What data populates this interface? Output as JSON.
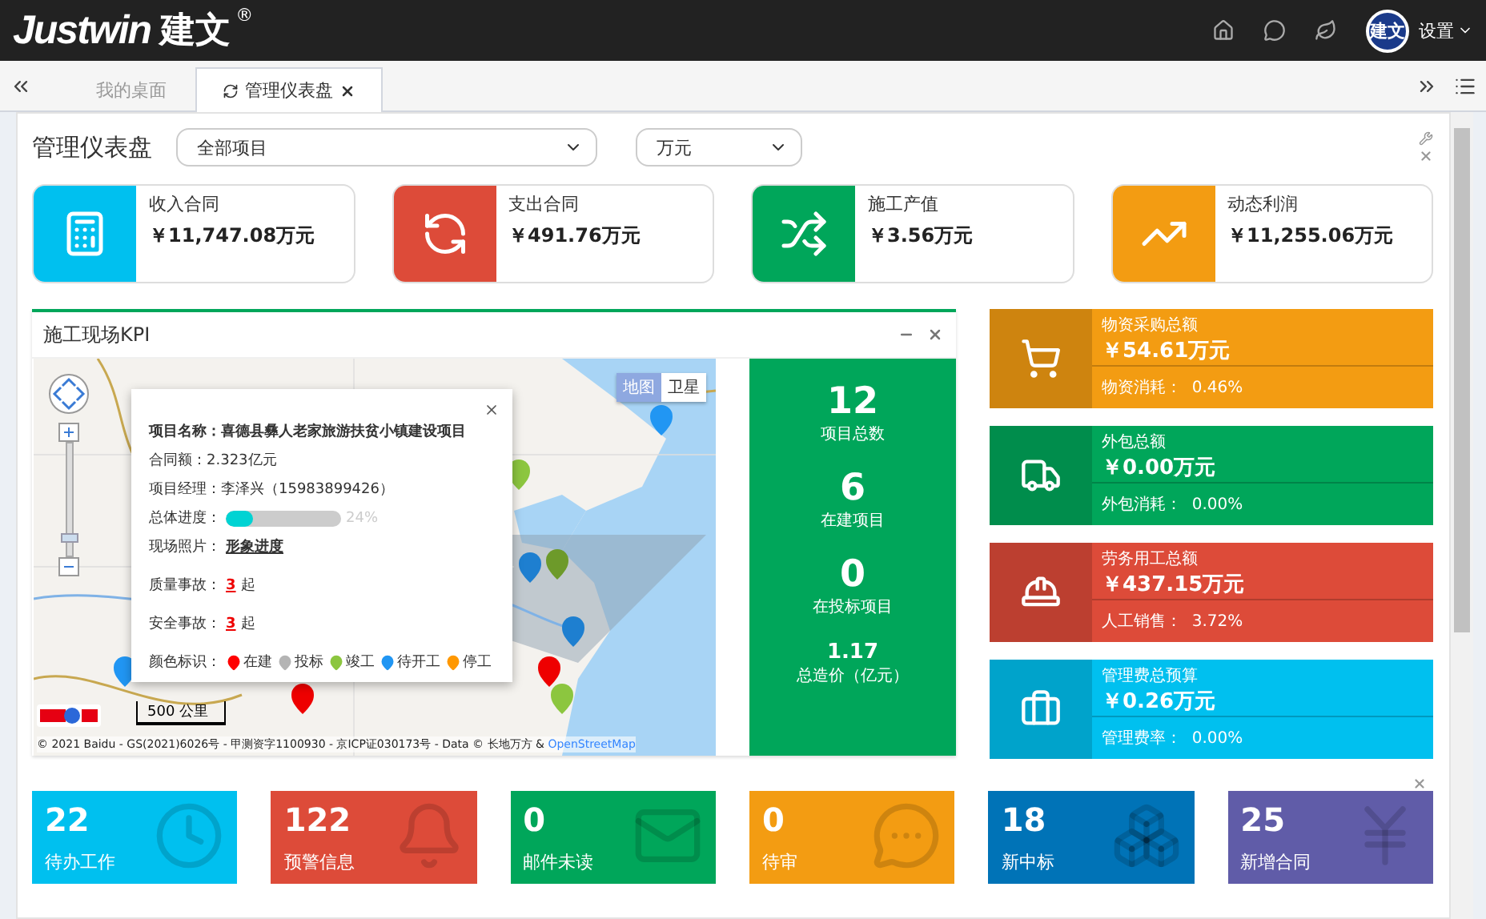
{
  "header": {
    "logo": "Justwin",
    "logo_cn": "建文",
    "registered": "®",
    "avatar": "建文",
    "user_menu": "设置"
  },
  "tabs": [
    {
      "label": "我的桌面",
      "selected": false
    },
    {
      "label": "管理仪表盘",
      "selected": true
    }
  ],
  "page": {
    "title": "管理仪表盘",
    "filters": [
      {
        "value": "全部项目"
      },
      {
        "value": "万元"
      }
    ]
  },
  "stat_cards": [
    {
      "label": "收入合同",
      "value": "￥11,747.08万元",
      "color": "#00c0ef"
    },
    {
      "label": "支出合同",
      "value": "￥491.76万元",
      "color": "#dd4b39"
    },
    {
      "label": "施工产值",
      "value": "￥3.56万元",
      "color": "#00a65a"
    },
    {
      "label": "动态利润",
      "value": "￥11,255.06万元",
      "color": "#f39c12"
    }
  ],
  "map_panel": {
    "title": "施工现场KPI",
    "map_types": [
      {
        "label": "地图",
        "selected": true
      },
      {
        "label": "卫星",
        "selected": false
      }
    ],
    "scale": "500 公里",
    "zoom_slider": {
      "level": 0.12
    },
    "attribution": "© 2021 Baidu - GS(2021)6026号 - 甲测资字1100930 - 京ICP证030173号 - Data © 长地万方 & ",
    "attribution_link": "OpenStreetMap",
    "popup": {
      "name_label": "项目名称：",
      "name": "喜德县彝人老家旅游扶贫小镇建设项目",
      "amount": "合同额：2.323亿元",
      "manager": "项目经理：李泽兴（15983899426）",
      "progress_label": "总体进度：",
      "progress": {
        "level": 0.24,
        "reading": "24%"
      },
      "photo_label": "现场照片：",
      "photo_link": "形象进度",
      "incidents": [
        {
          "label": "质量事故：",
          "count": "3",
          "unit": "起"
        },
        {
          "label": "安全事故：",
          "count": "3",
          "unit": "起"
        }
      ],
      "legend_label": "颜色标识：",
      "legend": [
        {
          "label": "在建",
          "color": "#ff0000"
        },
        {
          "label": "投标",
          "color": "#b4b4b4"
        },
        {
          "label": "竣工",
          "color": "#8cc63f"
        },
        {
          "label": "待开工",
          "color": "#2196f3"
        },
        {
          "label": "停工",
          "color": "#ff9800"
        }
      ]
    }
  },
  "kpi": [
    {
      "value": "12",
      "label": "项目总数"
    },
    {
      "value": "6",
      "label": "在建项目"
    },
    {
      "value": "0",
      "label": "在投标项目"
    },
    {
      "value": "1.17",
      "label": "总造价（亿元）"
    }
  ],
  "cost_cards": [
    {
      "title": "物资采购总额",
      "value": "￥54.61万元",
      "sub": "物资消耗：  0.46%",
      "color": "#f39c12"
    },
    {
      "title": "外包总额",
      "value": "￥0.00万元",
      "sub": "外包消耗：  0.00%",
      "color": "#00a65a"
    },
    {
      "title": "劳务用工总额",
      "value": "￥437.15万元",
      "sub": "人工销售：  3.72%",
      "color": "#dd4b39"
    },
    {
      "title": "管理费总预算",
      "value": "￥0.26万元",
      "sub": "管理费率：  0.00%",
      "color": "#00c0ef"
    }
  ],
  "tiles": [
    {
      "value": "22",
      "label": "待办工作",
      "color": "#00c0ef"
    },
    {
      "value": "122",
      "label": "预警信息",
      "color": "#dd4b39"
    },
    {
      "value": "0",
      "label": "邮件未读",
      "color": "#00a65a"
    },
    {
      "value": "0",
      "label": "待审",
      "color": "#f39c12"
    },
    {
      "value": "18",
      "label": "新中标",
      "color": "#0073b7"
    },
    {
      "value": "25",
      "label": "新增合同",
      "color": "#605ca8"
    }
  ]
}
